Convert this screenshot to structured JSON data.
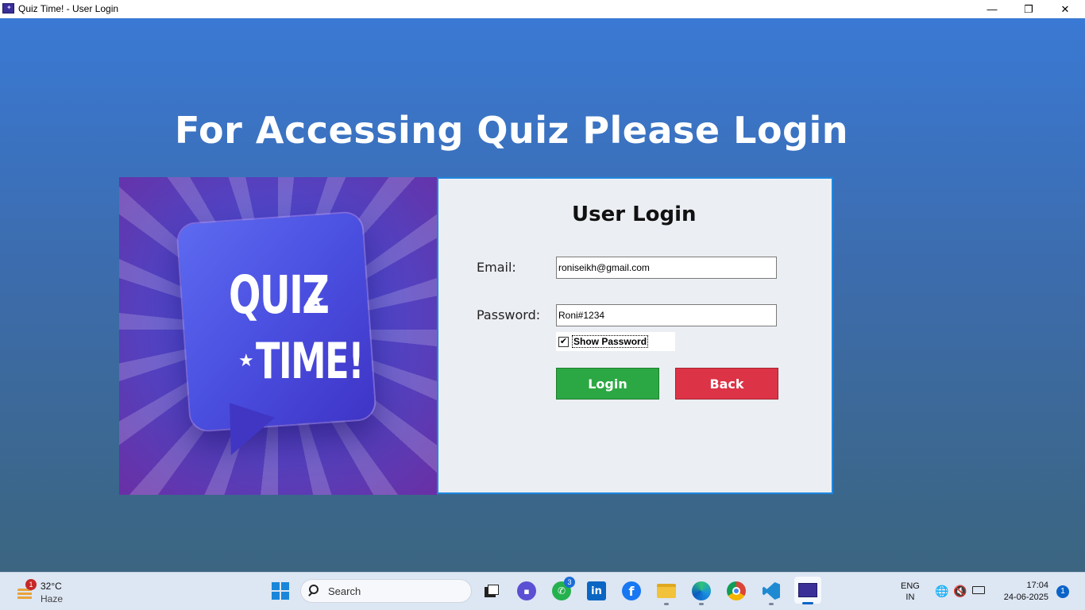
{
  "window": {
    "title": "Quiz Time! - User Login",
    "minimize_glyph": "—",
    "maximize_glyph": "❐",
    "close_glyph": "✕"
  },
  "page": {
    "headline": "For Accessing Quiz Please Login"
  },
  "banner": {
    "line1": "QUIZ",
    "line2": "TIME!",
    "star": "★",
    "colors": {
      "bubble": "#4a4fe0",
      "background": "#5a3cb6"
    }
  },
  "login_form": {
    "title": "User Login",
    "email_label": "Email:",
    "email_value": "roniseikh@gmail.com",
    "password_label": "Password:",
    "password_value": "Roni#1234",
    "show_password_label": "Show Password",
    "show_password_checked": true,
    "checkmark": "✔",
    "login_button": "Login",
    "back_button": "Back",
    "colors": {
      "login": "#2ba843",
      "back": "#dd3346",
      "panel_border": "#1e87e0"
    }
  },
  "taskbar": {
    "weather": {
      "temp": "32°C",
      "condition": "Haze",
      "alert_count": "1"
    },
    "search_placeholder": "Search",
    "apps": [
      {
        "name": "task-view",
        "badge": ""
      },
      {
        "name": "zoom",
        "badge": ""
      },
      {
        "name": "whatsapp",
        "badge": "3"
      },
      {
        "name": "linkedin",
        "badge": ""
      },
      {
        "name": "facebook",
        "badge": ""
      },
      {
        "name": "file-explorer",
        "badge": ""
      },
      {
        "name": "edge",
        "badge": ""
      },
      {
        "name": "chrome",
        "badge": ""
      },
      {
        "name": "vscode",
        "badge": ""
      },
      {
        "name": "quiz-app",
        "badge": ""
      }
    ],
    "linkedin_glyph": "in",
    "facebook_glyph": "f",
    "language": "ENG",
    "region": "IN",
    "time": "17:04",
    "date": "24-06-2025",
    "notification_count": "1"
  }
}
